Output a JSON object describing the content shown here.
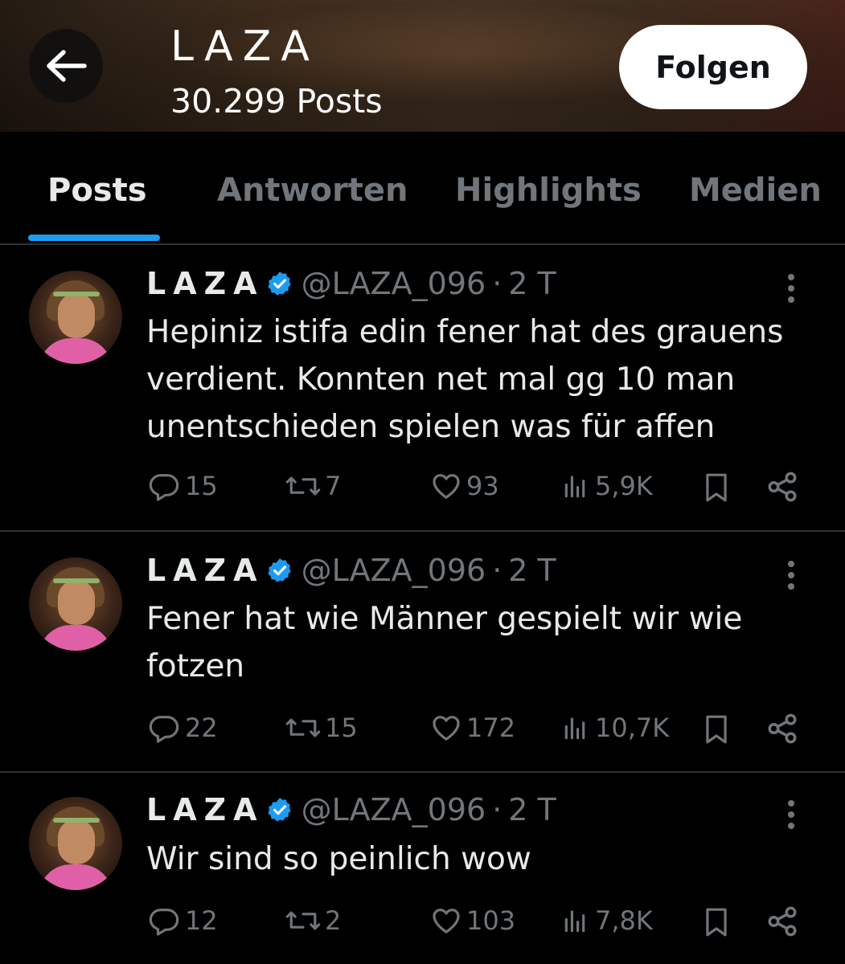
{
  "header": {
    "name": "LAZA",
    "post_count": "30.299 Posts",
    "follow_label": "Folgen"
  },
  "tabs": [
    {
      "label": "Posts",
      "active": true
    },
    {
      "label": "Antworten",
      "active": false
    },
    {
      "label": "Highlights",
      "active": false
    },
    {
      "label": "Medien",
      "active": false
    }
  ],
  "colors": {
    "accent": "#1d9bf0",
    "muted": "#71767b",
    "text": "#e7e9ea",
    "background": "#000000"
  },
  "posts": [
    {
      "name": "LAZA",
      "handle": "@LAZA_096",
      "dot": "·",
      "time": "2 T",
      "text": "Hepiniz istifa edin fener hat des grauens verdient. Konnten net mal gg 10 man unentschieden spielen was für affen",
      "replies": "15",
      "reposts": "7",
      "likes": "93",
      "views": "5,9K"
    },
    {
      "name": "LAZA",
      "handle": "@LAZA_096",
      "dot": "·",
      "time": "2 T",
      "text": "Fener hat wie Männer gespielt wir wie fotzen",
      "replies": "22",
      "reposts": "15",
      "likes": "172",
      "views": "10,7K"
    },
    {
      "name": "LAZA",
      "handle": "@LAZA_096",
      "dot": "·",
      "time": "2 T",
      "text": "Wir sind so peinlich wow",
      "replies": "12",
      "reposts": "2",
      "likes": "103",
      "views": "7,8K"
    }
  ]
}
